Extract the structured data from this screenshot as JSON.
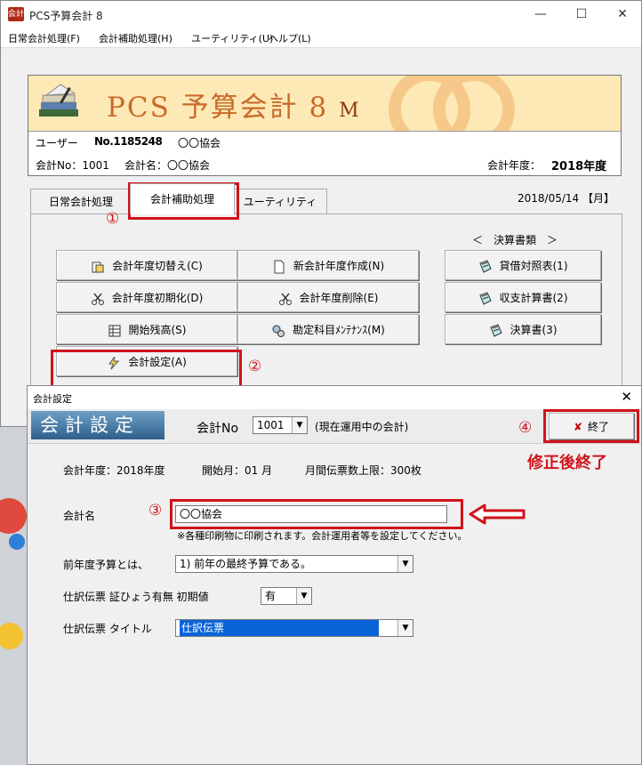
{
  "window": {
    "title": "PCS予算会計 8",
    "minimize": "—",
    "maximize": "☐",
    "close": "✕",
    "icon_text": "会計"
  },
  "menu": [
    "日常会計処理(F)",
    "会計補助処理(H)",
    "ユーティリティ(U)",
    "ヘルプ(L)"
  ],
  "banner": {
    "logo_text": "PCS 予算会計 8",
    "logo_suffix": "M",
    "user_label": "ユーザー",
    "user_code": "No.1185248",
    "user_name": "〇〇協会",
    "acct_no_label": "会計No：1001",
    "acct_name_label": "会計名：〇〇協会",
    "fiscal_label": "会計年度：",
    "fiscal_value": "2018年度"
  },
  "tabs": [
    "日常会計処理",
    "会計補助処理",
    "ユーティリティ"
  ],
  "date": "2018/05/14 【月】",
  "reports_header": "＜　決算書類　＞",
  "buttons": {
    "switch_year": "会計年度切替え(C)",
    "new_year": "新会計年度作成(N)",
    "balance_sheet": "貸借対照表(1)",
    "init_year": "会計年度初期化(D)",
    "delete_year": "会計年度削除(E)",
    "income_statement": "収支計算書(2)",
    "opening_balance": "開始残高(S)",
    "accounts_maint": "勘定科目ﾒﾝﾃﾅﾝｽ(M)",
    "settlement": "決算書(3)",
    "acct_settings": "会計設定(A)"
  },
  "annotations": {
    "n1": "①",
    "n2": "②",
    "n3": "③",
    "n4": "④",
    "finish_note": "修正後終了"
  },
  "dialog": {
    "title": "会計設定",
    "close": "✕",
    "banner": "会計設定",
    "acct_no_label": "会計No",
    "acct_no_value": "1001",
    "acct_no_note": "(現在運用中の会計)",
    "end_button": "終了",
    "info_year": "会計年度：2018年度",
    "info_start": "開始月：01 月",
    "info_limit": "月間伝票数上限：300枚",
    "name_label": "会計名",
    "name_value": "〇〇協会",
    "name_note": "※各種印刷物に印刷されます。会計運用者等を設定してください。",
    "prev_budget_label": "前年度予算とは、",
    "prev_budget_value": "1) 前年の最終予算である。",
    "slip_label": "仕訳伝票 証ひょう有無 初期値",
    "slip_value": "有",
    "slip_title_label": "仕訳伝票 タイトル",
    "slip_title_value": "仕訳伝票"
  },
  "colors": {
    "annotation_red": "#d0131b",
    "banner_bg": "#fde9b6",
    "logo_text": "#c96a2a",
    "selection_blue": "#0a64d8"
  }
}
